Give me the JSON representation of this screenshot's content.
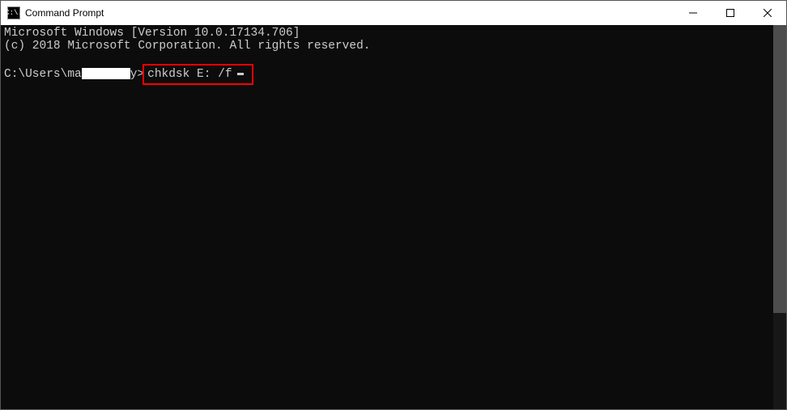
{
  "window": {
    "title": "Command Prompt",
    "icon_text": "C:\\."
  },
  "terminal": {
    "line1": "Microsoft Windows [Version 10.0.17134.706]",
    "line2": "(c) 2018 Microsoft Corporation. All rights reserved.",
    "prompt_prefix": "C:\\Users\\ma",
    "prompt_suffix": "y>",
    "command": "chkdsk E: /f"
  },
  "scrollbar": {
    "thumb_height_pct": 75
  }
}
